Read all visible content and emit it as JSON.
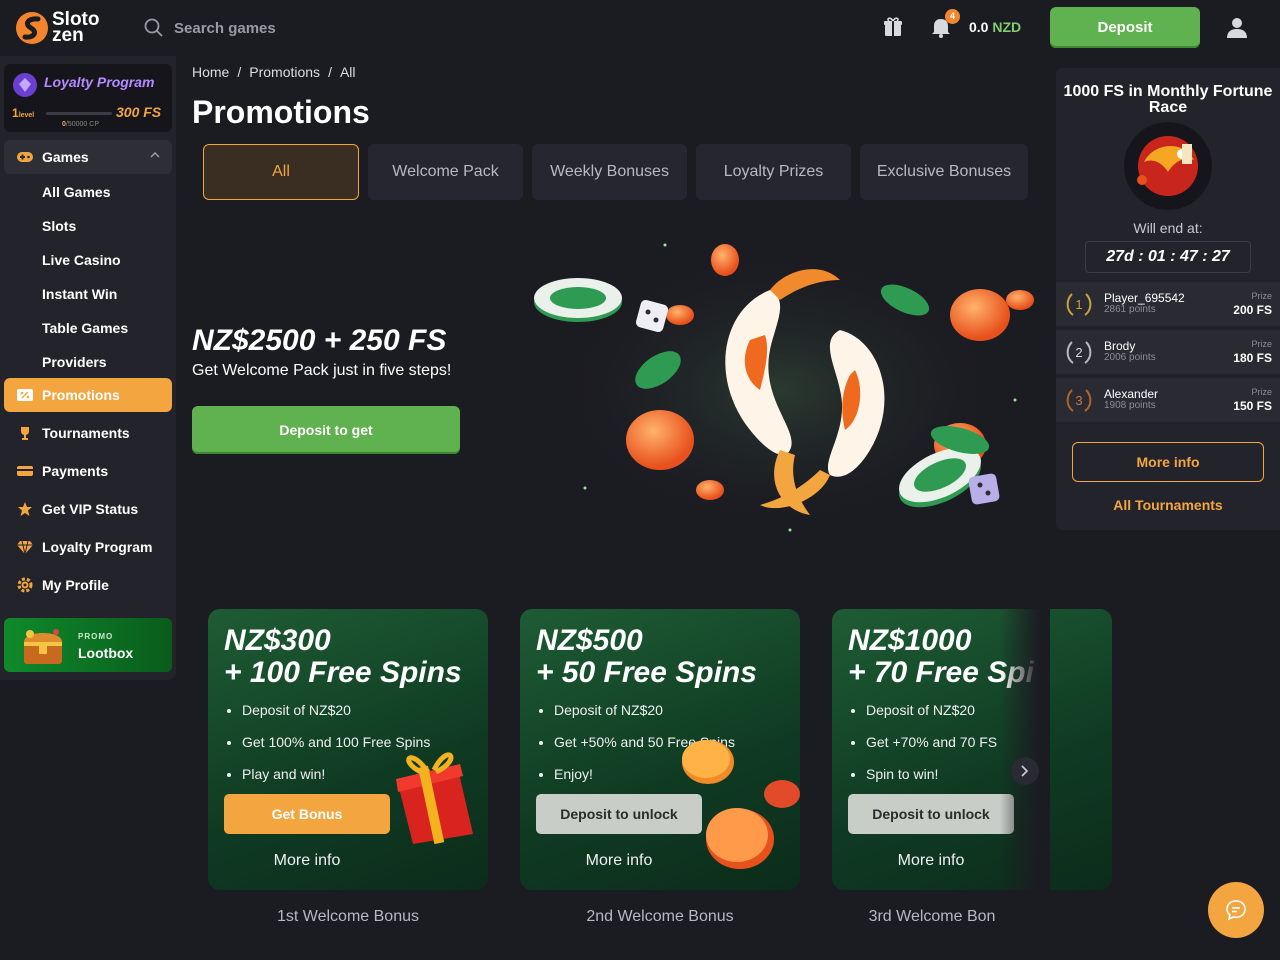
{
  "header": {
    "logo_text_1": "Sloto",
    "logo_text_2": "zen",
    "search_placeholder": "Search games",
    "notification_count": "4",
    "balance_value": "0.0",
    "balance_currency": "NZD",
    "deposit_label": "Deposit"
  },
  "sidebar": {
    "loyalty": {
      "title": "Loyalty Program",
      "level_number": "1",
      "level_word": "level",
      "reward": "300 FS",
      "cp_current": "0",
      "cp_total": "/50000 CP",
      "progress": 0
    },
    "items": [
      {
        "label": "Games",
        "icon": "gamepad-icon"
      },
      {
        "label": "All Games"
      },
      {
        "label": "Slots"
      },
      {
        "label": "Live Casino"
      },
      {
        "label": "Instant Win"
      },
      {
        "label": "Table Games"
      },
      {
        "label": "Providers"
      },
      {
        "label": "Promotions",
        "icon": "percent-icon"
      },
      {
        "label": "Tournaments",
        "icon": "trophy-icon"
      },
      {
        "label": "Payments",
        "icon": "card-icon"
      },
      {
        "label": "Get VIP Status",
        "icon": "star-icon"
      },
      {
        "label": "Loyalty Program",
        "icon": "diamond-icon"
      },
      {
        "label": "My Profile",
        "icon": "gear-icon"
      }
    ],
    "promo": {
      "tag": "PROMO",
      "name": "Lootbox"
    }
  },
  "main": {
    "breadcrumb": [
      "Home",
      "/",
      "Promotions",
      "/",
      "All"
    ],
    "title": "Promotions",
    "tabs": [
      {
        "label": "All",
        "active": true
      },
      {
        "label": "Welcome Pack"
      },
      {
        "label": "Weekly Bonuses"
      },
      {
        "label": "Loyalty Prizes"
      },
      {
        "label": "Exclusive Bonuses"
      }
    ],
    "hero": {
      "amount": "NZ$2500 + 250 FS",
      "subtitle": "Get Welcome Pack just in five steps!",
      "button": "Deposit to get"
    },
    "cards": [
      {
        "title_1": "NZ$300",
        "title_2": "+ 100 Free Spins",
        "bullets": [
          "Deposit of NZ$20",
          "Get 100% and 100 Free Spins",
          "Play and win!"
        ],
        "button": "Get Bonus",
        "more": "More info",
        "label": "1st Welcome Bonus"
      },
      {
        "title_1": "NZ$500",
        "title_2": "+ 50 Free Spins",
        "bullets": [
          "Deposit of NZ$20",
          "Get +50% and 50 Free Spins",
          "Enjoy!"
        ],
        "button": "Deposit to unlock",
        "more": "More info",
        "label": "2nd Welcome Bonus"
      },
      {
        "title_1": "NZ$1000",
        "title_2": "+ 70 Free Spi",
        "bullets": [
          "Deposit of NZ$20",
          "Get +70% and 70 FS",
          "Spin to win!"
        ],
        "button": "Deposit to unlock",
        "more": "More info",
        "label": "3rd Welcome Bon"
      }
    ]
  },
  "race": {
    "title": "1000 FS in Monthly Fortune Race",
    "end_label": "Will end at:",
    "timer": "27d : 01 : 47 : 27",
    "leaders": [
      {
        "rank": "1",
        "name": "Player_695542",
        "points": "2861 points",
        "prize_label": "Prize",
        "prize": "200 FS"
      },
      {
        "rank": "2",
        "name": "Brody",
        "points": "2006 points",
        "prize_label": "Prize",
        "prize": "180 FS"
      },
      {
        "rank": "3",
        "name": "Alexander",
        "points": "1908 points",
        "prize_label": "Prize",
        "prize": "150 FS"
      }
    ],
    "more_info": "More info",
    "all_tournaments": "All Tournaments"
  },
  "colors": {
    "accent": "#f3a640",
    "green": "#5fb24f",
    "bg": "#1b1b22",
    "panel": "#23232b"
  }
}
